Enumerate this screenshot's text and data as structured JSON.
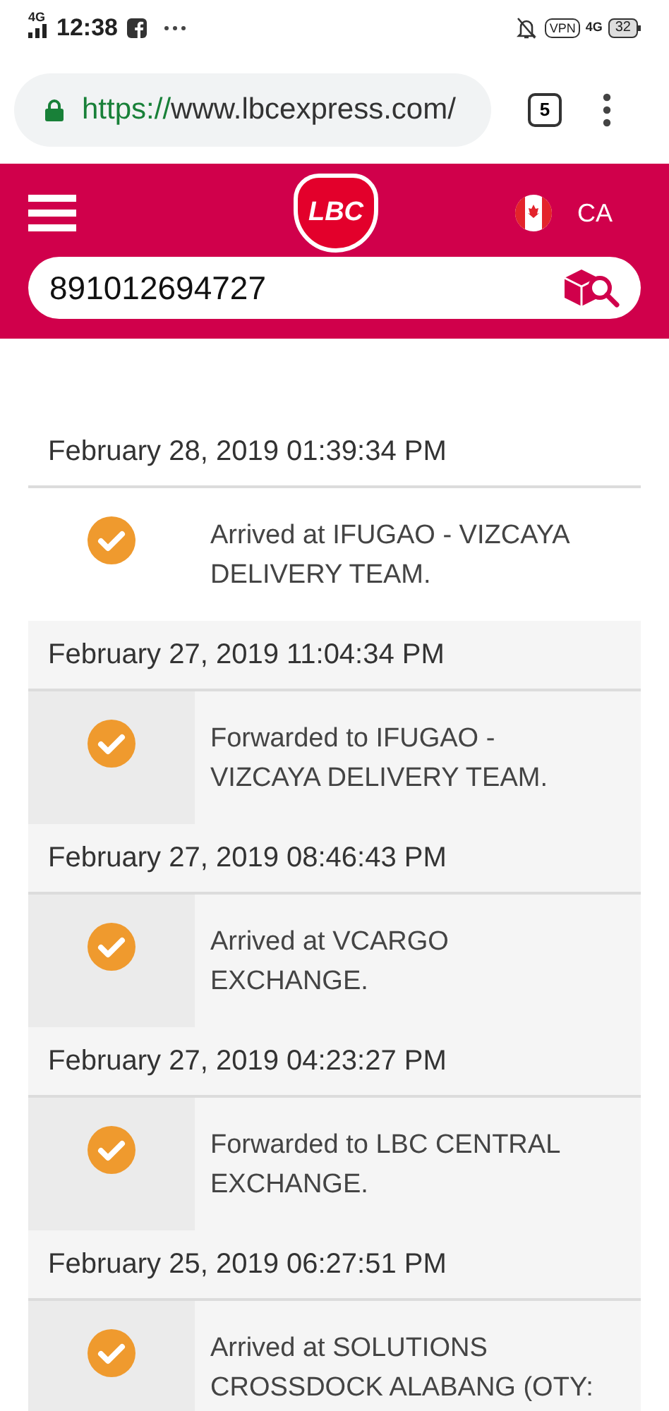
{
  "status_bar": {
    "network": "4G",
    "time": "12:38",
    "battery": "32",
    "data": "4G",
    "vpn": "VPN"
  },
  "browser": {
    "url_scheme": "https://",
    "url_rest": "www.lbcexpress.com/",
    "tab_count": "5"
  },
  "header": {
    "logo": "LBC",
    "country": "CA",
    "search_value": "891012694727"
  },
  "entries": [
    {
      "date": "February 28, 2019 01:39:34 PM",
      "status": "Arrived at IFUGAO - VIZCAYA DELIVERY TEAM.",
      "shaded": false
    },
    {
      "date": "February 27, 2019 11:04:34 PM",
      "status": "Forwarded to IFUGAO - VIZCAYA DELIVERY TEAM.",
      "shaded": true
    },
    {
      "date": "February 27, 2019 08:46:43 PM",
      "status": "Arrived at VCARGO EXCHANGE.",
      "shaded": true
    },
    {
      "date": "February 27, 2019 04:23:27 PM",
      "status": "Forwarded to LBC CENTRAL EXCHANGE.",
      "shaded": true
    },
    {
      "date": "February 25, 2019 06:27:51 PM",
      "status": "Arrived at SOLUTIONS CROSSDOCK ALABANG (OTY:",
      "shaded": true
    }
  ]
}
